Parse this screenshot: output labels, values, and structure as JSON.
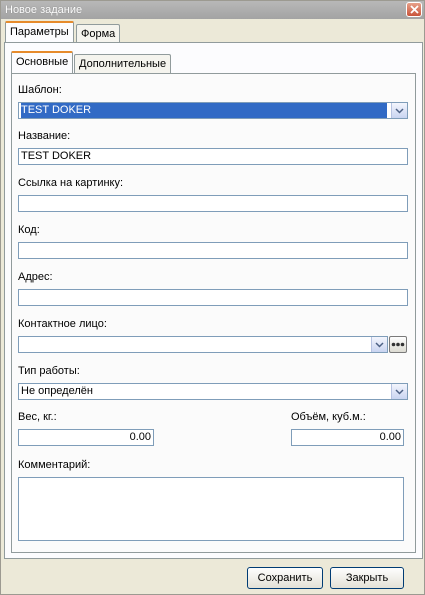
{
  "window": {
    "title": "Новое задание"
  },
  "outer_tabs": [
    {
      "label": "Параметры",
      "active": true
    },
    {
      "label": "Форма",
      "active": false
    }
  ],
  "inner_tabs": [
    {
      "label": "Основные",
      "active": true
    },
    {
      "label": "Дополнительные",
      "active": false
    }
  ],
  "form": {
    "template": {
      "label": "Шаблон:",
      "value": "TEST DOKER"
    },
    "name": {
      "label": "Название:",
      "value": "TEST DOKER"
    },
    "image_link": {
      "label": "Ссылка на картинку:",
      "value": ""
    },
    "code": {
      "label": "Код:",
      "value": ""
    },
    "address": {
      "label": "Адрес:",
      "value": ""
    },
    "contact": {
      "label": "Контактное лицо:",
      "value": ""
    },
    "work_type": {
      "label": "Тип работы:",
      "value": "Не определён"
    },
    "weight": {
      "label": "Вес, кг.:",
      "value": "0.00"
    },
    "volume": {
      "label": "Объём, куб.м.:",
      "value": "0.00"
    },
    "comment": {
      "label": "Комментарий:",
      "value": ""
    }
  },
  "buttons": {
    "save": "Сохранить",
    "close": "Закрыть"
  },
  "icons": {
    "close": "close-icon",
    "dropdown": "chevron-down-icon",
    "ellipsis": "ellipsis-icon"
  },
  "colors": {
    "selection": "#316ac5",
    "active_tab_accent": "#e68b2c",
    "field_border": "#7f9db9"
  }
}
